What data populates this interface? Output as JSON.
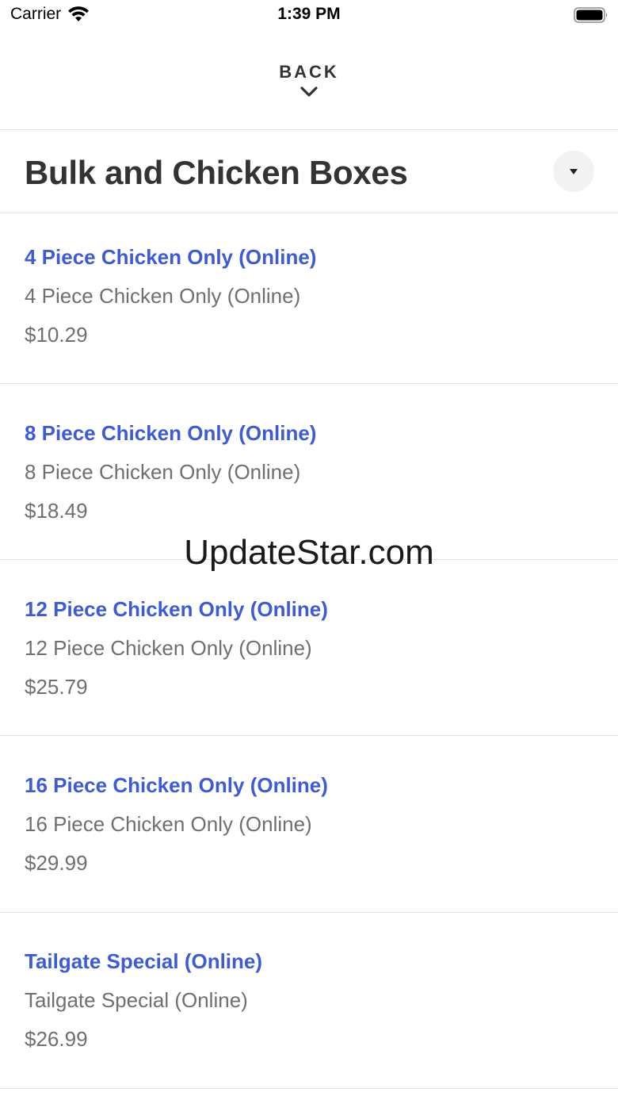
{
  "status": {
    "carrier": "Carrier",
    "time": "1:39 PM"
  },
  "nav": {
    "back_label": "BACK"
  },
  "category": {
    "title": "Bulk and Chicken Boxes"
  },
  "items": [
    {
      "name": "4 Piece Chicken Only (Online)",
      "description": "4 Piece Chicken Only (Online)",
      "price": "$10.29"
    },
    {
      "name": "8 Piece Chicken Only (Online)",
      "description": "8 Piece Chicken Only (Online)",
      "price": "$18.49"
    },
    {
      "name": "12 Piece Chicken Only (Online)",
      "description": "12 Piece Chicken Only (Online)",
      "price": "$25.79"
    },
    {
      "name": "16 Piece Chicken Only (Online)",
      "description": "16 Piece Chicken Only (Online)",
      "price": "$29.99"
    },
    {
      "name": "Tailgate Special (Online)",
      "description": "Tailgate Special (Online)",
      "price": "$26.99"
    }
  ],
  "watermark": "UpdateStar.com",
  "icons": {
    "wifi": "wifi-icon",
    "battery": "battery-icon",
    "back": "chevron-down-icon",
    "dropdown": "caret-down-icon"
  },
  "colors": {
    "item_name": "#3d5bd6",
    "item_text": "#6f6f6f",
    "title": "#333333"
  }
}
